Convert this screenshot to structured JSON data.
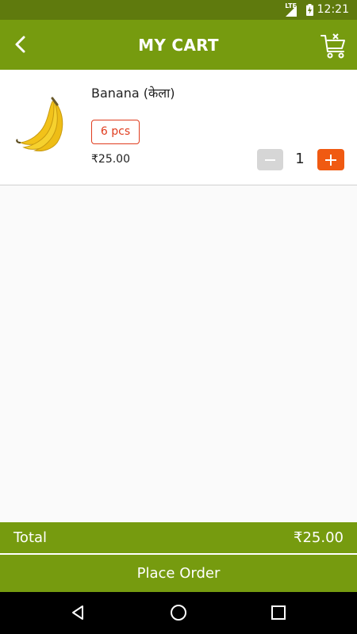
{
  "status_bar": {
    "network": "LTE",
    "time": "12:21"
  },
  "app_bar": {
    "title": "MY CART",
    "back_icon": "back-arrow-icon",
    "clear_cart_icon": "clear-cart-icon"
  },
  "cart": {
    "items": [
      {
        "name": "Banana (केला)",
        "unit": "6 pcs",
        "price": "₹25.00",
        "quantity": "1",
        "image_icon": "banana-image"
      }
    ]
  },
  "footer": {
    "total_label": "Total",
    "total_amount": "₹25.00",
    "place_order_label": "Place Order"
  },
  "nav_bar": {
    "back_icon": "nav-back-icon",
    "home_icon": "nav-home-icon",
    "recents_icon": "nav-recents-icon"
  },
  "colors": {
    "status_bar": "#5f7a0d",
    "primary": "#769b0f",
    "accent": "#f05a12",
    "unit_badge": "#e03c1e",
    "minus_button": "#d6d6d6",
    "background": "#fafafa"
  }
}
